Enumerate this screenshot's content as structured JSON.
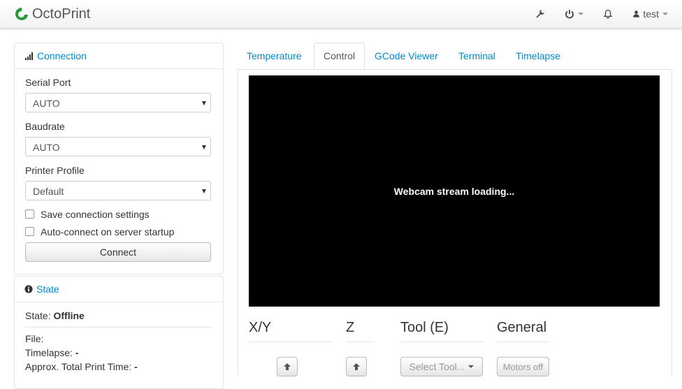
{
  "navbar": {
    "brand": "OctoPrint",
    "user": "test"
  },
  "connection": {
    "title": "Connection",
    "serial_port_label": "Serial Port",
    "serial_port_value": "AUTO",
    "baudrate_label": "Baudrate",
    "baudrate_value": "AUTO",
    "profile_label": "Printer Profile",
    "profile_value": "Default",
    "save_settings_label": "Save connection settings",
    "autoconnect_label": "Auto-connect on server startup",
    "connect_button": "Connect"
  },
  "state": {
    "title": "State",
    "state_label": "State:",
    "state_value": "Offline",
    "file_label": "File:",
    "file_value": "",
    "timelapse_label": "Timelapse:",
    "timelapse_value": "-",
    "approx_label": "Approx. Total Print Time:",
    "approx_value": "-"
  },
  "tabs": [
    {
      "label": "Temperature"
    },
    {
      "label": "Control"
    },
    {
      "label": "GCode Viewer"
    },
    {
      "label": "Terminal"
    },
    {
      "label": "Timelapse"
    }
  ],
  "webcam": {
    "status": "Webcam stream loading..."
  },
  "control": {
    "xy_title": "X/Y",
    "z_title": "Z",
    "tool_title": "Tool (E)",
    "general_title": "General",
    "select_tool": "Select Tool...",
    "motors_off": "Motors off"
  },
  "colors": {
    "link": "#0088cc",
    "brand_green": "#2a9a3a"
  }
}
